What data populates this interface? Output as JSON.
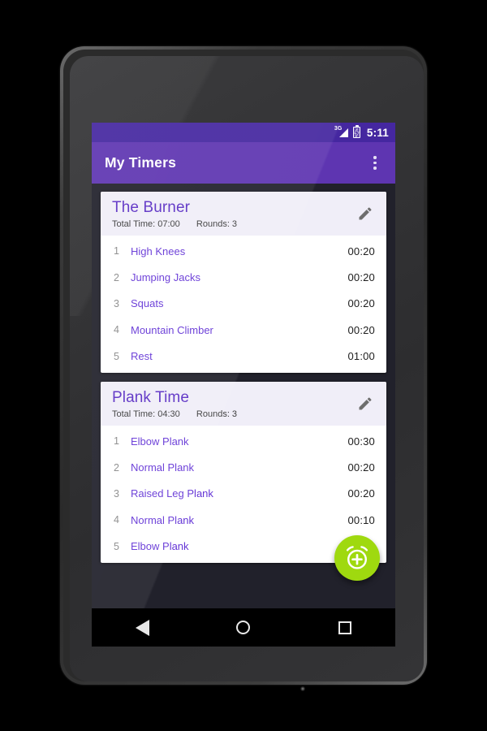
{
  "status_bar": {
    "network_label": "3G",
    "network_icon": "signal-3g-icon",
    "battery_icon": "battery-charging-icon",
    "time": "5:11"
  },
  "app_bar": {
    "title": "My Timers",
    "overflow_icon": "overflow-menu-icon"
  },
  "colors": {
    "status_bar": "#4527a0",
    "app_bar": "#5e35b1",
    "accent_purple": "#6536d6",
    "title_purple": "#5b2fc4",
    "fab_green": "#9fd90f",
    "card_header": "#f0eef8",
    "screen_background": "#21212b"
  },
  "cards": [
    {
      "title": "The Burner",
      "total_time_label": "Total Time: 07:00",
      "rounds_label": "Rounds: 3",
      "edit_icon": "pencil-edit-icon",
      "rows": [
        {
          "num": "1",
          "name": "High Knees",
          "time": "00:20"
        },
        {
          "num": "2",
          "name": "Jumping Jacks",
          "time": "00:20"
        },
        {
          "num": "3",
          "name": "Squats",
          "time": "00:20"
        },
        {
          "num": "4",
          "name": "Mountain Climber",
          "time": "00:20"
        },
        {
          "num": "5",
          "name": "Rest",
          "time": "01:00"
        }
      ]
    },
    {
      "title": "Plank Time",
      "total_time_label": "Total Time: 04:30",
      "rounds_label": "Rounds: 3",
      "edit_icon": "pencil-edit-icon",
      "rows": [
        {
          "num": "1",
          "name": "Elbow Plank",
          "time": "00:30"
        },
        {
          "num": "2",
          "name": "Normal Plank",
          "time": "00:20"
        },
        {
          "num": "3",
          "name": "Raised Leg Plank",
          "time": "00:20"
        },
        {
          "num": "4",
          "name": "Normal Plank",
          "time": "00:10"
        },
        {
          "num": "5",
          "name": "Elbow Plank",
          "time": ""
        }
      ]
    }
  ],
  "fab": {
    "icon": "add-alarm-icon",
    "label": "Add timer"
  },
  "nav_bar": {
    "back_icon": "back-triangle-icon",
    "home_icon": "home-circle-icon",
    "recents_icon": "recents-square-icon"
  }
}
